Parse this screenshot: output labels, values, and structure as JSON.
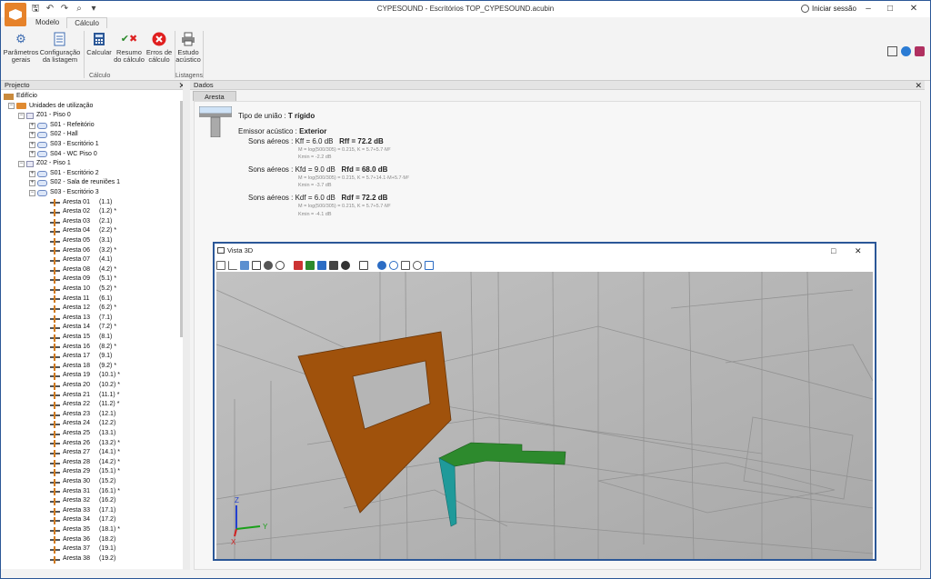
{
  "window": {
    "title": "CYPESOUND - Escritórios TOP_CYPESOUND.acubin",
    "signin": "Iniciar sessão"
  },
  "tabs": [
    "Modelo",
    "Cálculo"
  ],
  "ribbon": {
    "buttons": [
      {
        "label": "Parâmetros\ngerais",
        "icon": "gear-icon"
      },
      {
        "label": "Configuração\nda listagem",
        "icon": "document-settings-icon"
      },
      {
        "label": "Calcular",
        "icon": "calculator-icon"
      },
      {
        "label": "Resumo\ndo cálculo",
        "icon": "check-cross-icon"
      },
      {
        "label": "Erros de\ncálculo",
        "icon": "error-icon"
      },
      {
        "label": "Estudo\nacústico",
        "icon": "printer-icon"
      }
    ],
    "groups": [
      "Cálculo",
      "Listagens"
    ]
  },
  "project_panel": {
    "title": "Projecto",
    "root": "Edifício",
    "units": "Unidades de utilização",
    "zones": [
      {
        "label": "Z01 - Piso 0",
        "rooms": [
          "S01 - Refeitório",
          "S02 - Hall",
          "S03 - Escritório 1",
          "S04 - WC Piso 0"
        ]
      },
      {
        "label": "Z02 - Piso 1",
        "rooms": [
          "S01 - Escritório 2",
          "S02 - Sala de reuniões 1",
          "S03 - Escritório 3"
        ]
      }
    ],
    "edges": [
      {
        "name": "Aresta 01",
        "ref": "(1.1)"
      },
      {
        "name": "Aresta 02",
        "ref": "(1.2) *"
      },
      {
        "name": "Aresta 03",
        "ref": "(2.1)"
      },
      {
        "name": "Aresta 04",
        "ref": "(2.2) *"
      },
      {
        "name": "Aresta 05",
        "ref": "(3.1)"
      },
      {
        "name": "Aresta 06",
        "ref": "(3.2) *"
      },
      {
        "name": "Aresta 07",
        "ref": "(4.1)"
      },
      {
        "name": "Aresta 08",
        "ref": "(4.2) *"
      },
      {
        "name": "Aresta 09",
        "ref": "(5.1) *"
      },
      {
        "name": "Aresta 10",
        "ref": "(5.2) *"
      },
      {
        "name": "Aresta 11",
        "ref": "(6.1)"
      },
      {
        "name": "Aresta 12",
        "ref": "(6.2) *"
      },
      {
        "name": "Aresta 13",
        "ref": "(7.1)"
      },
      {
        "name": "Aresta 14",
        "ref": "(7.2) *"
      },
      {
        "name": "Aresta 15",
        "ref": "(8.1)"
      },
      {
        "name": "Aresta 16",
        "ref": "(8.2) *"
      },
      {
        "name": "Aresta 17",
        "ref": "(9.1)"
      },
      {
        "name": "Aresta 18",
        "ref": "(9.2) *"
      },
      {
        "name": "Aresta 19",
        "ref": "(10.1) *"
      },
      {
        "name": "Aresta 20",
        "ref": "(10.2) *"
      },
      {
        "name": "Aresta 21",
        "ref": "(11.1) *"
      },
      {
        "name": "Aresta 22",
        "ref": "(11.2) *"
      },
      {
        "name": "Aresta 23",
        "ref": "(12.1)"
      },
      {
        "name": "Aresta 24",
        "ref": "(12.2)"
      },
      {
        "name": "Aresta 25",
        "ref": "(13.1)"
      },
      {
        "name": "Aresta 26",
        "ref": "(13.2) *"
      },
      {
        "name": "Aresta 27",
        "ref": "(14.1) *"
      },
      {
        "name": "Aresta 28",
        "ref": "(14.2) *"
      },
      {
        "name": "Aresta 29",
        "ref": "(15.1) *"
      },
      {
        "name": "Aresta 30",
        "ref": "(15.2)"
      },
      {
        "name": "Aresta 31",
        "ref": "(16.1) *"
      },
      {
        "name": "Aresta 32",
        "ref": "(16.2)"
      },
      {
        "name": "Aresta 33",
        "ref": "(17.1)"
      },
      {
        "name": "Aresta 34",
        "ref": "(17.2)"
      },
      {
        "name": "Aresta 35",
        "ref": "(18.1) *"
      },
      {
        "name": "Aresta 36",
        "ref": "(18.2)"
      },
      {
        "name": "Aresta 37",
        "ref": "(19.1)"
      },
      {
        "name": "Aresta 38",
        "ref": "(19.2)"
      }
    ]
  },
  "data_panel": {
    "title": "Dados",
    "subtab": "Aresta",
    "union_label": "Tipo de união :",
    "union_value": "T rígido",
    "emitter_label": "Emissor acústico :",
    "emitter_value": "Exterior",
    "rows": [
      {
        "label": "Sons aéreos",
        "k": "Kff = 6.0 dB",
        "r": "Rff = 72.2 dB",
        "formula": "M = log(500/305) = 0.215, K = 5.7+5.7·M²",
        "kmin": "Kmin = -2.2 dB"
      },
      {
        "label": "Sons aéreos",
        "k": "Kfd = 9.0 dB",
        "r": "Rfd = 68.0 dB",
        "formula": "M = log(500/305) = 0.215, K = 5.7+14.1·M+5.7·M²",
        "kmin": "Kmin = -3.7 dB"
      },
      {
        "label": "Sons aéreos",
        "k": "Kdf = 6.0 dB",
        "r": "Rdf = 72.2 dB",
        "formula": "M = log(500/305) = 0.215, K = 5.7+5.7·M²",
        "kmin": "Kmin = -4.1 dB"
      }
    ]
  },
  "view3d": {
    "title": "Vista 3D",
    "axes": {
      "z": "Z",
      "y": "Y",
      "x": "X"
    }
  },
  "colors": {
    "accent": "#2b5797",
    "orange_wall": "#a0520c",
    "green_slab": "#2d8a2d",
    "teal_wall": "#1f9a9a"
  }
}
